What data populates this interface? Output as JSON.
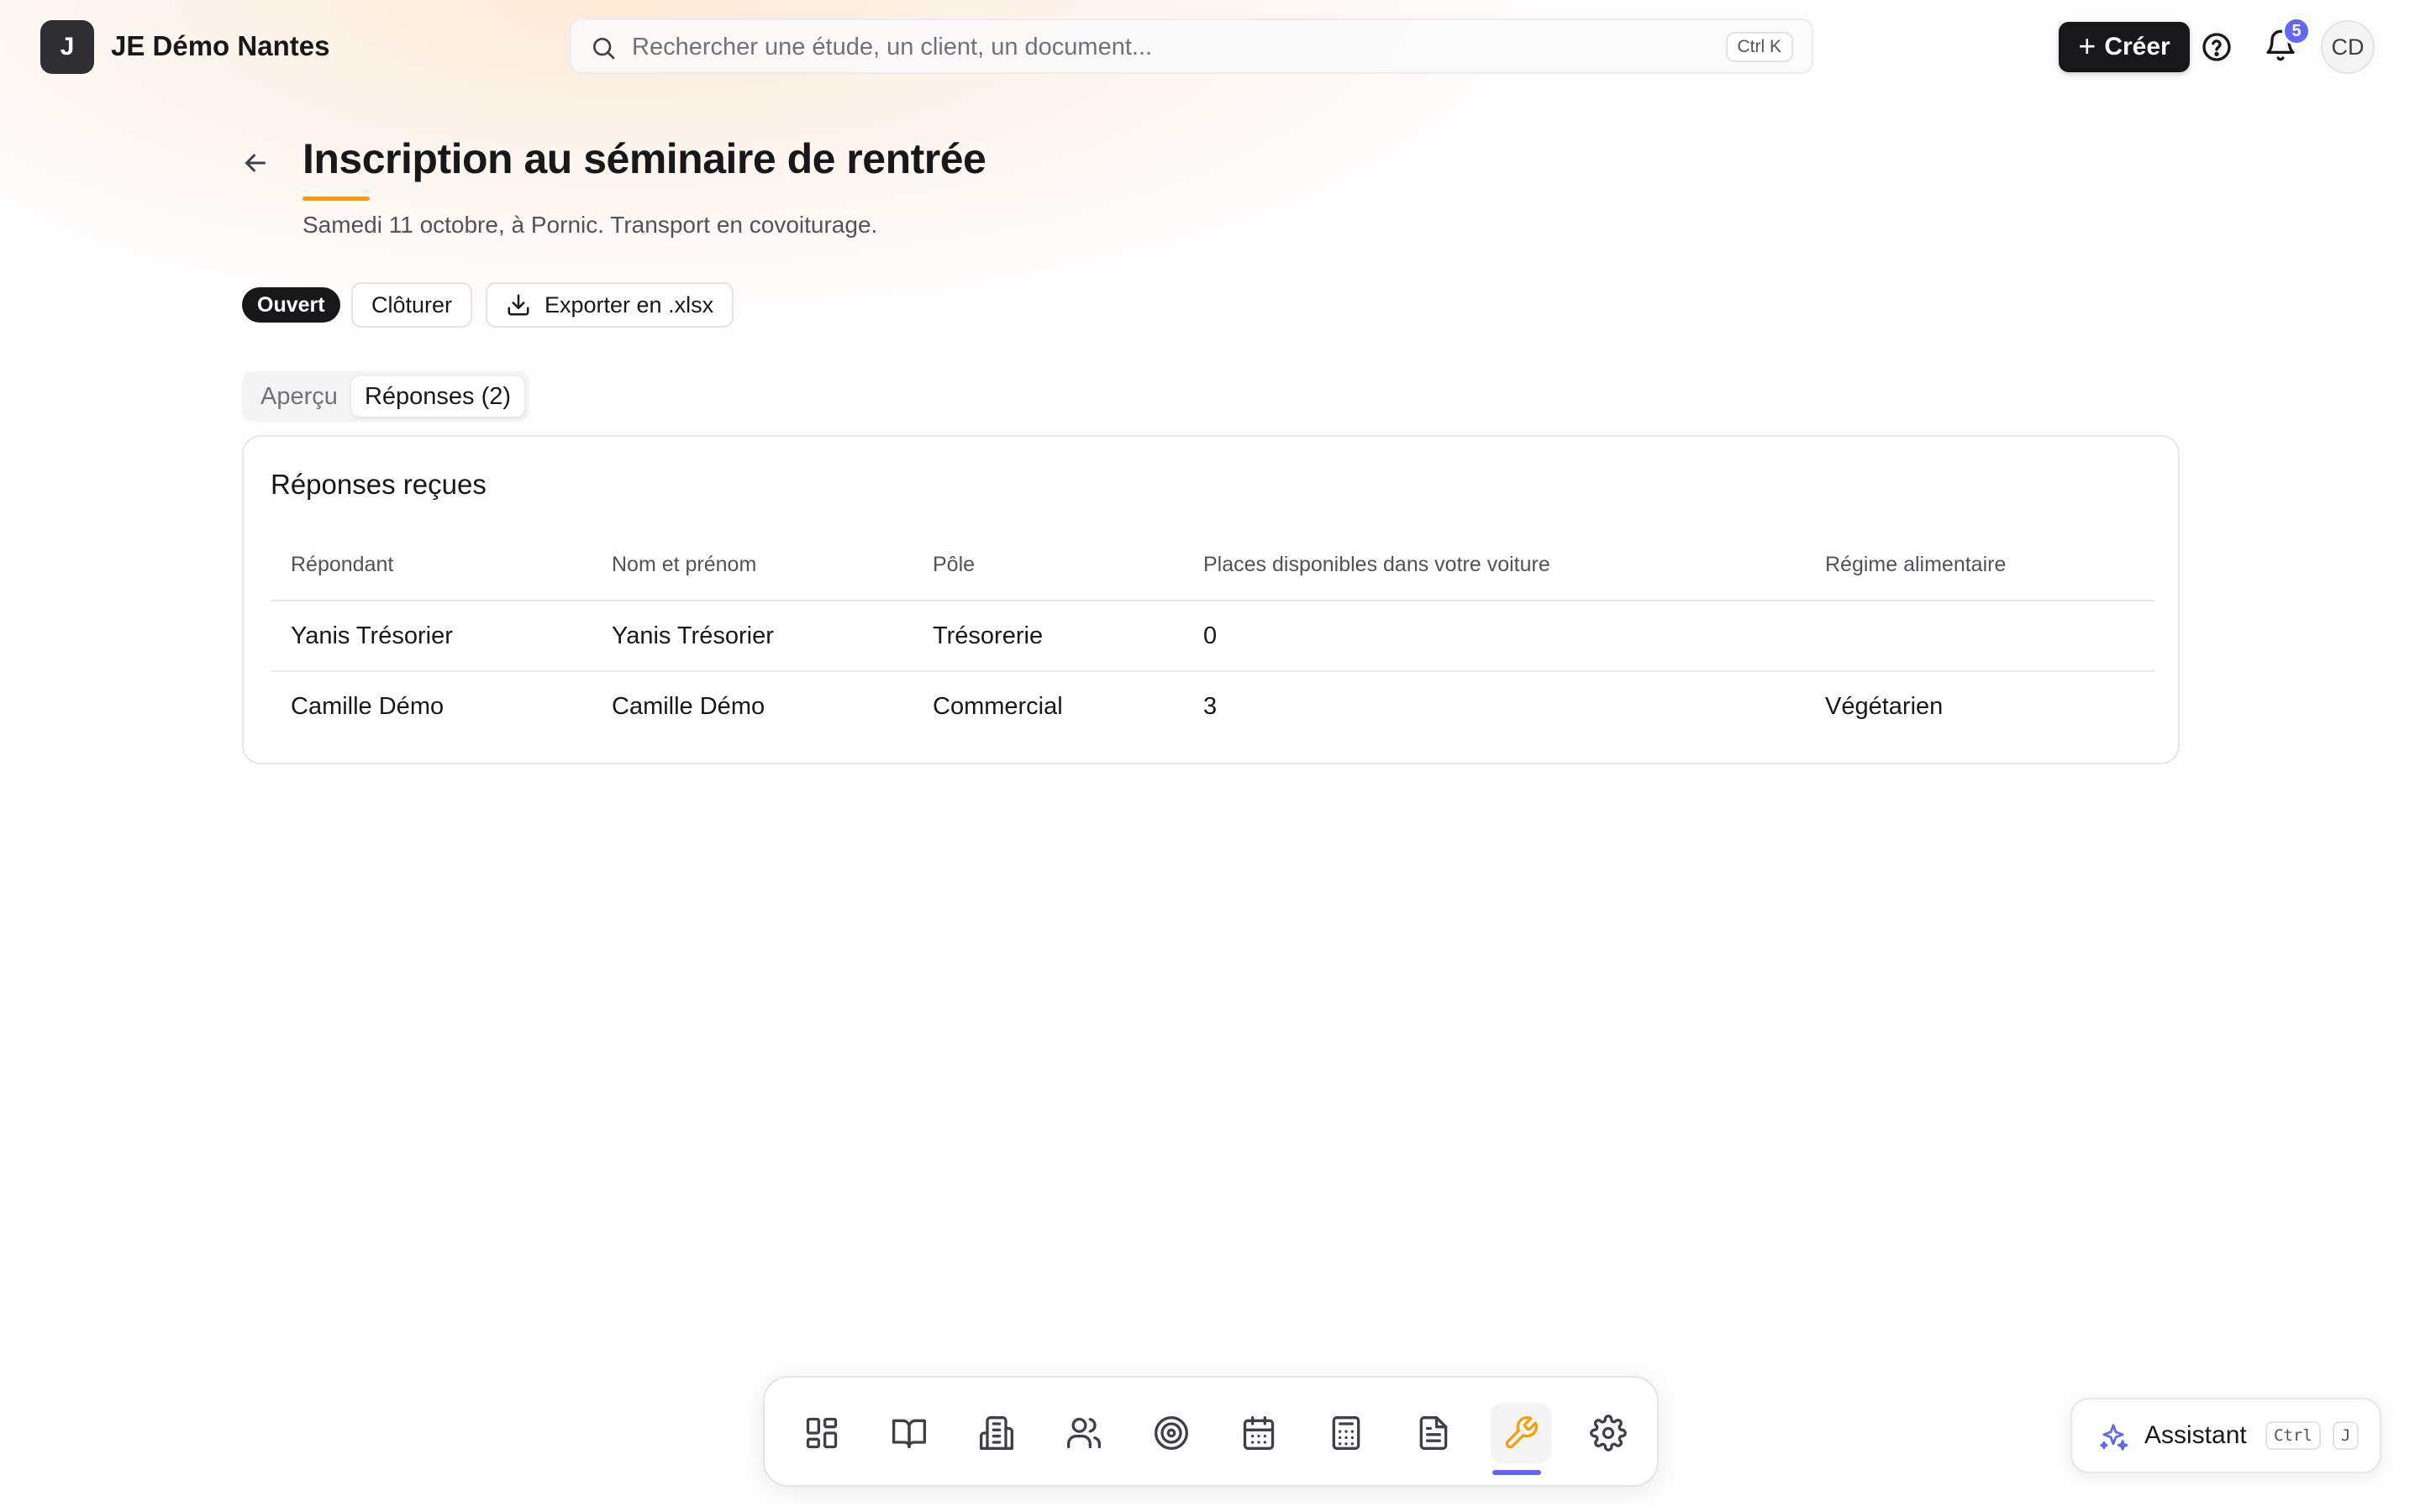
{
  "app": {
    "logo_letter": "J",
    "org_name": "JE Démo Nantes"
  },
  "search": {
    "placeholder": "Rechercher une étude, un client, un document...",
    "shortcut": "Ctrl K"
  },
  "header_actions": {
    "create_label": "Créer",
    "notification_count": "5",
    "avatar_initials": "CD"
  },
  "page": {
    "title": "Inscription au séminaire de rentrée",
    "subtitle": "Samedi 11 octobre, à Pornic. Transport en covoiturage.",
    "status": "Ouvert",
    "close_label": "Clôturer",
    "export_label": "Exporter en .xlsx"
  },
  "tabs": [
    {
      "label": "Aperçu",
      "active": false
    },
    {
      "label": "Réponses (2)",
      "active": true
    }
  ],
  "responses": {
    "title": "Réponses reçues",
    "columns": [
      "Répondant",
      "Nom et prénom",
      "Pôle",
      "Places disponibles dans votre voiture",
      "Régime alimentaire"
    ],
    "rows": [
      [
        "Yanis Trésorier",
        "Yanis Trésorier",
        "Trésorerie",
        "0",
        ""
      ],
      [
        "Camille Démo",
        "Camille Démo",
        "Commercial",
        "3",
        "Végétarien"
      ]
    ]
  },
  "dock": {
    "items": [
      {
        "icon": "dashboard-icon"
      },
      {
        "icon": "book-icon"
      },
      {
        "icon": "building-icon"
      },
      {
        "icon": "users-icon"
      },
      {
        "icon": "target-icon"
      },
      {
        "icon": "calendar-icon"
      },
      {
        "icon": "calculator-icon"
      },
      {
        "icon": "document-icon"
      },
      {
        "icon": "wrench-icon",
        "active": true
      },
      {
        "icon": "gear-icon"
      }
    ],
    "active_color": "#f59e0b",
    "indicator_color": "#6366f1"
  },
  "assistant": {
    "label": "Assistant",
    "key1": "Ctrl",
    "key2": "J"
  },
  "colors": {
    "accent": "#f59e0b",
    "primary_dark": "#18181b",
    "badge": "#6366f1"
  }
}
